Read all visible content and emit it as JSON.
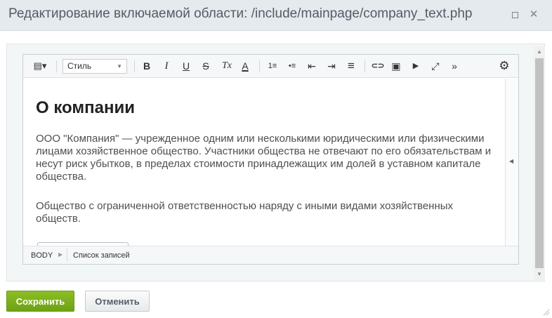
{
  "window": {
    "title": "Редактирование включаемой области: /include/mainpage/company_text.php",
    "maximize_icon": "maximize-icon",
    "close_icon": "close-icon",
    "close_glyph": "✕"
  },
  "toolbar": {
    "style_select": {
      "value": "Стиль"
    },
    "tools": [
      {
        "name": "view-mode-icon",
        "glyph": "▤▾"
      },
      {
        "name": "bold-icon",
        "glyph": "B"
      },
      {
        "name": "italic-icon",
        "glyph": "I"
      },
      {
        "name": "underline-icon",
        "glyph": "U"
      },
      {
        "name": "strikethrough-icon",
        "glyph": "S"
      },
      {
        "name": "remove-format-icon",
        "glyph": "Tx"
      },
      {
        "name": "font-color-icon",
        "glyph": "A"
      },
      {
        "name": "ordered-list-icon",
        "glyph": "1≡"
      },
      {
        "name": "unordered-list-icon",
        "glyph": "•≡"
      },
      {
        "name": "outdent-icon",
        "glyph": "⇤"
      },
      {
        "name": "indent-icon",
        "glyph": "⇥"
      },
      {
        "name": "align-icon",
        "glyph": "≡"
      },
      {
        "name": "link-icon",
        "glyph": "⊂⊃"
      },
      {
        "name": "image-icon",
        "glyph": "▣"
      },
      {
        "name": "video-icon",
        "glyph": "▶"
      },
      {
        "name": "fullscreen-icon",
        "glyph": "⤢"
      },
      {
        "name": "more-icon",
        "glyph": "»"
      },
      {
        "name": "settings-icon",
        "glyph": "⚙"
      }
    ]
  },
  "editor": {
    "heading": "О компании",
    "paragraphs": [
      "ООО \"Компания\" — учрежденное одним или несколькими юридическими или физическими лицами хозяйственное общество. Участники общества не отвечают по его обязательствам и несут риск убытков, в пределах стоимости принадлежащих им долей в уставном капитале общества.",
      "Общество с ограниченной ответственностью наряду с иными видами хозяйственных обществ."
    ],
    "side_toggle_icon": "collapse-arrow-icon"
  },
  "statusbar": {
    "crumbs": [
      "BODY",
      "Список записей"
    ]
  },
  "buttons": {
    "save": "Сохранить",
    "cancel": "Отменить"
  },
  "colors": {
    "save_button": "#7aad1a",
    "titlebar": "#e4eaed"
  }
}
